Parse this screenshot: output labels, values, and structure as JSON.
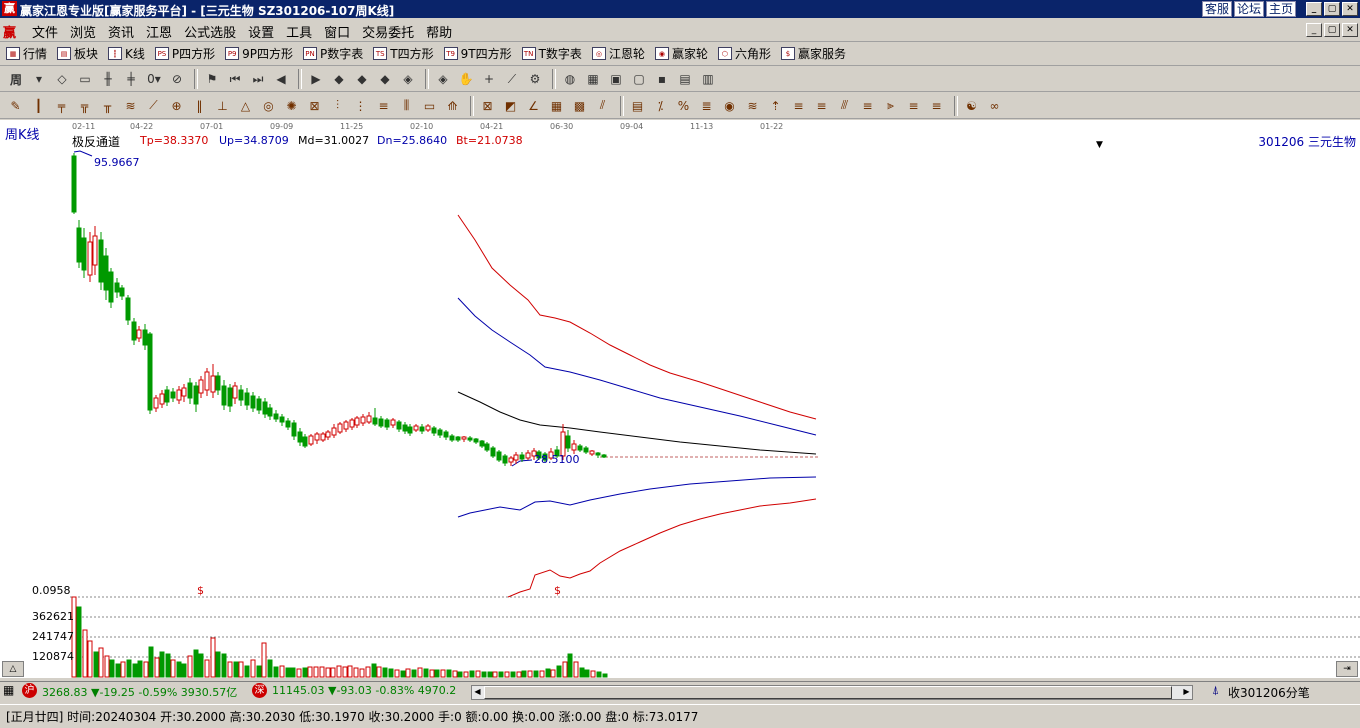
{
  "window": {
    "title": "赢家江恩专业版[赢家服务平台] - [三元生物   SZ301206-107周K线]",
    "links": [
      "客服",
      "论坛",
      "主页"
    ],
    "buttons": [
      "_",
      "▢",
      "✕"
    ]
  },
  "menu": {
    "items": [
      "文件",
      "浏览",
      "资讯",
      "江恩",
      "公式选股",
      "设置",
      "工具",
      "窗口",
      "交易委托",
      "帮助"
    ]
  },
  "toolbar1": {
    "items": [
      {
        "icon": "grid-icon",
        "glyph": "▦",
        "label": "行情"
      },
      {
        "icon": "blocks-icon",
        "glyph": "▤",
        "label": "板块"
      },
      {
        "icon": "kline-icon",
        "glyph": "┇",
        "label": "K线"
      },
      {
        "icon": "p-square-icon",
        "glyph": "PS",
        "label": "P四方形"
      },
      {
        "icon": "p9-icon",
        "glyph": "P9",
        "label": "9P四方形"
      },
      {
        "icon": "pn-icon",
        "glyph": "PN",
        "label": "P数字表"
      },
      {
        "icon": "ts-icon",
        "glyph": "TS",
        "label": "T四方形"
      },
      {
        "icon": "t9-icon",
        "glyph": "T9",
        "label": "9T四方形"
      },
      {
        "icon": "tn-icon",
        "glyph": "TN",
        "label": "T数字表"
      },
      {
        "icon": "gann-wheel-icon",
        "glyph": "◎",
        "label": "江恩轮"
      },
      {
        "icon": "winner-wheel-icon",
        "glyph": "◉",
        "label": "赢家轮"
      },
      {
        "icon": "hexagon-icon",
        "glyph": "⬡",
        "label": "六角形"
      },
      {
        "icon": "dollar-icon",
        "glyph": "$",
        "label": "赢家服务"
      }
    ]
  },
  "toolbar2": {
    "period": "周",
    "buttons": [
      {
        "icon": "dropdown-icon",
        "glyph": "▾"
      },
      {
        "icon": "pattern1-icon",
        "glyph": "◇"
      },
      {
        "icon": "pattern2-icon",
        "glyph": "▭"
      },
      {
        "icon": "pattern3-icon",
        "glyph": "╫"
      },
      {
        "icon": "pattern4-icon",
        "glyph": "╪"
      },
      {
        "icon": "indicator-select-icon",
        "glyph": "0▾"
      },
      {
        "icon": "mark-icon",
        "glyph": "⊘"
      },
      {
        "icon": "flag-icon",
        "glyph": "⚑"
      },
      {
        "icon": "first-icon",
        "glyph": "⏮"
      },
      {
        "icon": "last-icon",
        "glyph": "⏭"
      },
      {
        "icon": "left-icon",
        "glyph": "◀"
      },
      {
        "icon": "right-icon",
        "glyph": "▶"
      },
      {
        "icon": "diamond1-icon",
        "glyph": "◆"
      },
      {
        "icon": "diamond2-icon",
        "glyph": "◆"
      },
      {
        "icon": "diamond3-icon",
        "glyph": "◆"
      },
      {
        "icon": "diamond4-icon",
        "glyph": "◈"
      },
      {
        "icon": "diamond5-icon",
        "glyph": "◈"
      },
      {
        "icon": "hand-icon",
        "glyph": "✋"
      },
      {
        "icon": "crosshair-icon",
        "glyph": "+"
      },
      {
        "icon": "line-tool-icon",
        "glyph": "⟋"
      },
      {
        "icon": "fan-icon",
        "glyph": "⚙"
      },
      {
        "icon": "compass-icon",
        "glyph": "◍"
      },
      {
        "icon": "calendar-icon",
        "glyph": "▦"
      },
      {
        "icon": "monitor-icon",
        "glyph": "▣"
      },
      {
        "icon": "window-icon",
        "glyph": "▢"
      },
      {
        "icon": "save-icon",
        "glyph": "▪"
      },
      {
        "icon": "print-icon",
        "glyph": "▤"
      },
      {
        "icon": "truck-icon",
        "glyph": "▥"
      }
    ]
  },
  "toolbar3": {
    "buttons": [
      {
        "icon": "pen-icon",
        "glyph": "✎"
      },
      {
        "icon": "vlines-icon",
        "glyph": "┃"
      },
      {
        "icon": "grid1-icon",
        "glyph": "╤"
      },
      {
        "icon": "grid2-icon",
        "glyph": "╦"
      },
      {
        "icon": "grid3-icon",
        "glyph": "╥"
      },
      {
        "icon": "wave-icon",
        "glyph": "≋"
      },
      {
        "icon": "brush-icon",
        "glyph": "⟋"
      },
      {
        "icon": "circle-grid-icon",
        "glyph": "⊕"
      },
      {
        "icon": "bars-icon",
        "glyph": "‖"
      },
      {
        "icon": "ruler-icon",
        "glyph": "⊥"
      },
      {
        "icon": "triangle-icon",
        "glyph": "△"
      },
      {
        "icon": "spiral-icon",
        "glyph": "◎"
      },
      {
        "icon": "star-icon",
        "glyph": "✺"
      },
      {
        "icon": "box-icon",
        "glyph": "⊠"
      },
      {
        "icon": "cycles-icon",
        "glyph": "⫶"
      },
      {
        "icon": "ticks-icon",
        "glyph": "⋮"
      },
      {
        "icon": "fib-icon",
        "glyph": "≡"
      },
      {
        "icon": "time-icon",
        "glyph": "⫼"
      },
      {
        "icon": "rect-icon",
        "glyph": "▭"
      },
      {
        "icon": "fan-lines-icon",
        "glyph": "⟰"
      },
      {
        "icon": "box-x-icon",
        "glyph": "⊠"
      },
      {
        "icon": "box-diag-icon",
        "glyph": "◩"
      },
      {
        "icon": "angle-icon",
        "glyph": "∠"
      },
      {
        "icon": "hatch-icon",
        "glyph": "▦"
      },
      {
        "icon": "square-grid-icon",
        "glyph": "▩"
      },
      {
        "icon": "slash-lines-icon",
        "glyph": "⫽"
      },
      {
        "icon": "table-icon",
        "glyph": "▤"
      },
      {
        "icon": "percent-x-icon",
        "glyph": "⁒"
      },
      {
        "icon": "percent-icon",
        "glyph": "%"
      },
      {
        "icon": "levels1-icon",
        "glyph": "≣"
      },
      {
        "icon": "coin-icon",
        "glyph": "◉"
      },
      {
        "icon": "levels2-icon",
        "glyph": "≋"
      },
      {
        "icon": "arrow-up-icon",
        "glyph": "⇡"
      },
      {
        "icon": "levels3-icon",
        "glyph": "≡"
      },
      {
        "icon": "levels4-icon",
        "glyph": "≡"
      },
      {
        "icon": "levels5-icon",
        "glyph": "⫻"
      },
      {
        "icon": "levels6-icon",
        "glyph": "≡"
      },
      {
        "icon": "levels7-icon",
        "glyph": "⫸"
      },
      {
        "icon": "levels8-icon",
        "glyph": "≡"
      },
      {
        "icon": "levels9-icon",
        "glyph": "≡"
      },
      {
        "icon": "taiji-icon",
        "glyph": "☯"
      },
      {
        "icon": "infinity-icon",
        "glyph": "∞"
      }
    ]
  },
  "chart": {
    "period_label": "周K线",
    "indicator": {
      "name": "极反通道",
      "tp": "Tp=38.3370",
      "up": "Up=34.8709",
      "md": "Md=31.0027",
      "dn": "Dn=25.8640",
      "bt": "Bt=21.0738"
    },
    "stock_label": "301206  三元生物",
    "high_label": "95.9667",
    "low_label": "28.5100",
    "dollar_marks": [
      "$",
      "$"
    ],
    "volume_ticks": [
      "0.0958",
      "362621",
      "241747",
      "120874"
    ],
    "colors": {
      "up": "#d00000",
      "down": "#009900",
      "mid": "#000000",
      "band": "#0000aa",
      "bg": "#ffffff"
    }
  },
  "chart_data": {
    "type": "candlestick",
    "x_labels": [
      "02-11",
      "04-22",
      "07-01",
      "09-09",
      "11-25",
      "02-10",
      "04-21",
      "06-30",
      "09-04",
      "11-13",
      "01-22"
    ],
    "y_marks": {
      "high": 95.9667,
      "low": 28.51
    },
    "channel_latest": {
      "Tp": 38.337,
      "Up": 34.8709,
      "Md": 31.0027,
      "Dn": 25.864,
      "Bt": 21.0738
    },
    "volume_axis": [
      0.0958,
      362621,
      241747,
      120874
    ]
  },
  "status1": {
    "sh_badge": "沪",
    "sh": "3268.83 ▼-19.25 -0.59% 3930.57亿",
    "sz_badge": "深",
    "sz": "11145.03 ▼-93.03 -0.83% 4970.2",
    "right_text": "收301206分笔"
  },
  "status2": {
    "text": "[正月廿四] 时间:20240304 开:30.2000 高:30.2030 低:30.1970 收:30.2000 手:0 额:0.00 换:0.00 涨:0.00 盘:0 标:73.0177"
  }
}
